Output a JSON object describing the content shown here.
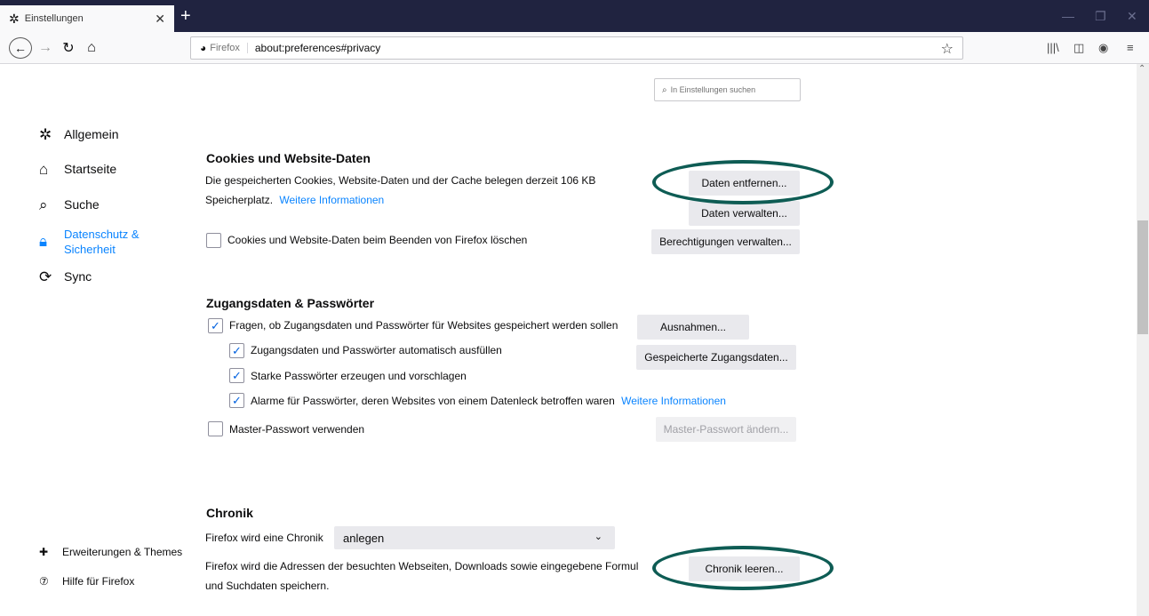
{
  "tab": {
    "title": "Einstellungen",
    "close": "✕"
  },
  "newtab": "+",
  "urlbar": {
    "identity": "Firefox",
    "url": "about:preferences#privacy"
  },
  "search": {
    "placeholder": "In Einstellungen suchen"
  },
  "sidebar": {
    "items": [
      {
        "label": "Allgemein"
      },
      {
        "label": "Startseite"
      },
      {
        "label": "Suche"
      },
      {
        "label": "Datenschutz & Sicherheit"
      },
      {
        "label": "Sync"
      }
    ],
    "footer": [
      {
        "label": "Erweiterungen & Themes"
      },
      {
        "label": "Hilfe für Firefox"
      }
    ]
  },
  "cookies": {
    "heading": "Cookies und Website-Daten",
    "desc_line1": "Die gespeicherten Cookies, Website-Daten und der Cache belegen derzeit 106 KB",
    "desc_line2": "Speicherplatz.",
    "more_info": "Weitere Informationen",
    "remove_button": "Daten entfernen...",
    "manage_button": "Daten verwalten...",
    "delete_on_close": "Cookies und Website-Daten beim Beenden von Firefox löschen",
    "permissions_button": "Berechtigungen verwalten..."
  },
  "logins": {
    "heading": "Zugangsdaten & Passwörter",
    "ask_save": "Fragen, ob Zugangsdaten und Passwörter für Websites gespeichert werden sollen",
    "exceptions_button": "Ausnahmen...",
    "autofill": "Zugangsdaten und Passwörter automatisch ausfüllen",
    "saved_logins_button": "Gespeicherte Zugangsdaten...",
    "suggest_strong": "Starke Passwörter erzeugen und vorschlagen",
    "breach_alerts": "Alarme für Passwörter, deren Websites von einem Datenleck betroffen waren",
    "breach_more_info": "Weitere Informationen",
    "master_password": "Master-Passwort verwenden",
    "change_master_button": "Master-Passwort ändern..."
  },
  "history": {
    "heading": "Chronik",
    "mode_label": "Firefox wird eine Chronik",
    "mode_value": "anlegen",
    "desc_line1": "Firefox wird die Adressen der besuchten Webseiten, Downloads sowie eingegebene Formul",
    "desc_line2": "und Suchdaten speichern.",
    "clear_button": "Chronik leeren..."
  },
  "colors": {
    "accent": "#0a84ff",
    "tabstrip": "#202340",
    "annotation": "#0e5c54"
  }
}
